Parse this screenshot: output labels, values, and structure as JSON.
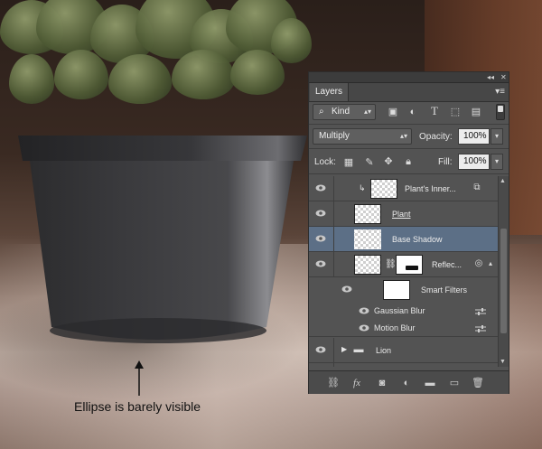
{
  "annotation": {
    "text": "Ellipse is barely visible"
  },
  "panel": {
    "tab_label": "Layers",
    "kind_label": "Kind",
    "blend_mode": "Multiply",
    "opacity_label": "Opacity:",
    "opacity_value": "100%",
    "lock_label": "Lock:",
    "fill_label": "Fill:",
    "fill_value": "100%",
    "layers": [
      {
        "name": "Plant's Inner..."
      },
      {
        "name": "Plant"
      },
      {
        "name": "Base Shadow"
      },
      {
        "name": "Reflec..."
      },
      {
        "name": "Smart Filters"
      },
      {
        "name": "Gaussian Blur"
      },
      {
        "name": "Motion Blur"
      },
      {
        "name": "Lion"
      }
    ],
    "icons": {
      "filter_icons": [
        "image-filter-icon",
        "adjustment-filter-icon",
        "type-filter-icon",
        "shape-filter-icon",
        "smart-object-filter-icon"
      ],
      "lock_icons": [
        "lock-transparent-icon",
        "lock-image-icon",
        "lock-position-icon",
        "lock-all-icon"
      ],
      "bottom_icons": [
        "link-icon",
        "fx-icon",
        "mask-icon",
        "adjustment-icon",
        "group-icon",
        "new-layer-icon",
        "trash-icon"
      ]
    },
    "colors": {
      "panel_bg": "#535353",
      "selected_row": "#5c6f86"
    }
  }
}
